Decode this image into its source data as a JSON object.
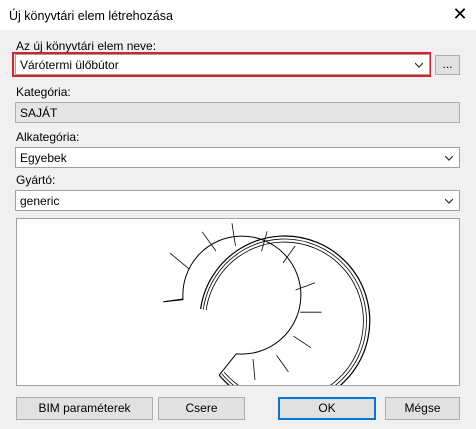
{
  "window": {
    "title": "Új könyvtári elem létrehozása"
  },
  "form": {
    "name_label": "Az új könyvtári elem neve:",
    "name_value": "Várótermi ülőbútor",
    "browse_label": "...",
    "category_label": "Kategória:",
    "category_value": "SAJÁT",
    "subcategory_label": "Alkategória:",
    "subcategory_value": "Egyebek",
    "manufacturer_label": "Gyártó:",
    "manufacturer_value": "generic"
  },
  "buttons": {
    "bim": "BIM paraméterek",
    "replace": "Csere",
    "ok": "OK",
    "cancel": "Mégse"
  },
  "icons": {
    "close": "close-icon",
    "dropdown": "chevron-down-icon"
  }
}
